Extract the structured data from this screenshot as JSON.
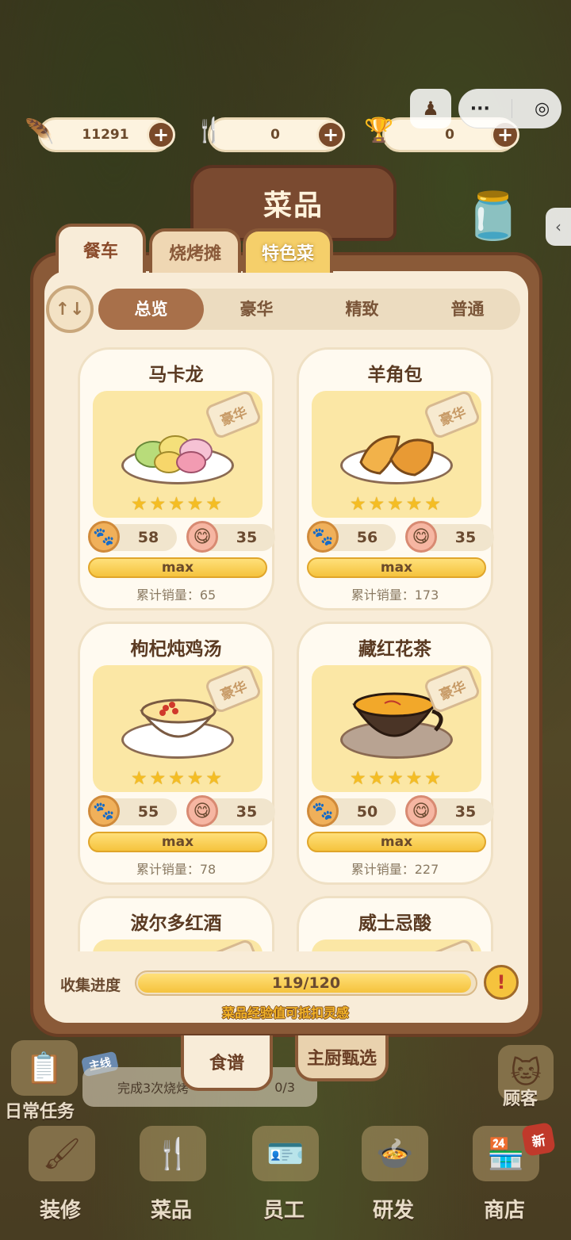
{
  "resources": [
    {
      "icon": "feather-icon",
      "value": "11291"
    },
    {
      "icon": "fork-icon",
      "value": "0"
    },
    {
      "icon": "gold-bowl-icon",
      "value": "0"
    }
  ],
  "panel": {
    "title": "菜品",
    "category_tabs": [
      "餐车",
      "烧烤摊",
      "特色菜"
    ],
    "active_category": "餐车",
    "sort_label": "↑↓",
    "filters": [
      "总览",
      "豪华",
      "精致",
      "普通"
    ],
    "active_filter": "总览"
  },
  "dishes": [
    {
      "name": "马卡龙",
      "badge": "豪华",
      "stars": "★★★★★",
      "stat1": "58",
      "stat2": "35",
      "level": "max",
      "sales": "累计销量：65"
    },
    {
      "name": "羊角包",
      "badge": "豪华",
      "stars": "★★★★★",
      "stat1": "56",
      "stat2": "35",
      "level": "max",
      "sales": "累计销量：173"
    },
    {
      "name": "枸杞炖鸡汤",
      "badge": "豪华",
      "stars": "★★★★★",
      "stat1": "55",
      "stat2": "35",
      "level": "max",
      "sales": "累计销量：78"
    },
    {
      "name": "藏红花茶",
      "badge": "豪华",
      "stars": "★★★★★",
      "stat1": "50",
      "stat2": "35",
      "level": "max",
      "sales": "累计销量：227"
    },
    {
      "name": "波尔多红酒",
      "badge": "豪华"
    },
    {
      "name": "威士忌酸",
      "badge": "豪华"
    }
  ],
  "progress": {
    "label": "收集进度",
    "text": "119/120",
    "fraction": 0.9917,
    "alert": "!",
    "tip": "菜品经验值可抵扣灵感"
  },
  "bottom_tabs": [
    "食谱",
    "主厨甄选"
  ],
  "hud": {
    "daily_tasks": "日常任务",
    "quest_tag": "主线",
    "quest_text": "完成3次烧烤",
    "quest_count": "0/3",
    "customers": "顾客",
    "new_badge": "新",
    "nav": [
      "装修",
      "菜品",
      "员工",
      "研发",
      "商店"
    ]
  },
  "capsule": {
    "more": "···",
    "target": "◎"
  }
}
